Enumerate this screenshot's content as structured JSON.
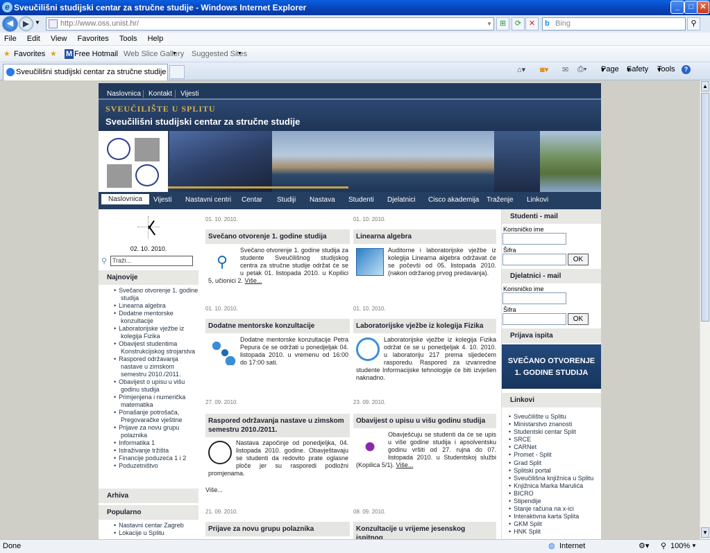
{
  "window": {
    "title": "Sveučilišni studijski centar za stručne studije - Windows Internet Explorer"
  },
  "address": {
    "url": "http://www.oss.unist.hr/",
    "search_placeholder": "Bing"
  },
  "menu": [
    "File",
    "Edit",
    "View",
    "Favorites",
    "Tools",
    "Help"
  ],
  "favorites": {
    "label": "Favorites",
    "items": [
      "Free Hotmail",
      "Web Slice Gallery",
      "Suggested Sites"
    ]
  },
  "tab": {
    "title": "Sveučilišni studijski centar za stručne studije"
  },
  "commands": [
    "Page",
    "Safety",
    "Tools"
  ],
  "site": {
    "topnav": [
      "Naslovnica",
      "Kontakt",
      "Vijesti"
    ],
    "university": "SVEUČILIŠTE U SPLITU",
    "centre": "Sveučilišni studijski centar za stručne studije",
    "mainnav": [
      "Naslovnica",
      "Vijesti",
      "Nastavni centri",
      "Centar",
      "Studiji",
      "Nastava",
      "Studenti",
      "Djelatnici",
      "Cisco akademija",
      "Traženje",
      "Linkovi"
    ],
    "clock_date": "02. 10. 2010.",
    "search_placeholder": "Traži...",
    "najnovije_title": "Najnovije",
    "najnovije": [
      "Svečano otvorenje 1. godine studija",
      "Linearna algebra",
      "Dodatne mentorske konzultacije",
      "Laboratorijske vježbe iz kolegija Fizika",
      "Obavijest studentima Konstrukcijskog strojarstva",
      "Raspored održavanja nastave u zimskom semestru 2010./2011.",
      "Obavijest o upisu u višu godinu studija",
      "Primjenjena i numerička matematika",
      "Ponašanje potrošača, Pregovaračke vještine",
      "Prijave za novu grupu polaznika",
      "Informatika 1",
      "Istraživanje tržišta",
      "Financije poduzeća 1 i 2",
      "Poduzetništvo"
    ],
    "arhiva_title": "Arhiva",
    "popularno_title": "Popularno",
    "popularno": [
      "Nastavni centar Zagreb",
      "Lokacije u Splitu"
    ],
    "news": [
      {
        "date": "01. 10. 2010.",
        "title": "Svečano otvorenje 1. godine studija",
        "body": "Svečano otvorenje 1. godine studija za studente Sveučilišnog studijskog centra za stručne studije održat će se u petak 01. listopada 2010. u Kopilici 5, učionici 2.",
        "more": "Više..."
      },
      {
        "date": "01. 10. 2010.",
        "title": "Linearna algebra",
        "body": "Auditorne i laboratorijske vježbe iz kolegija Linearna algebra održavat će se počevši od 05. listopada 2010. (nakon održanog prvog predavanja).",
        "more": ""
      },
      {
        "date": "01. 10. 2010.",
        "title": "Dodatne mentorske konzultacije",
        "body": "Dodatne mentorske konzultacije Petra Pepura će se održati u ponedjeljak 04. listopada 2010. u vremenu od 16:00 do 17:00 sati.",
        "more": ""
      },
      {
        "date": "01. 10. 2010.",
        "title": "Laboratorijske vježbe iz kolegija Fizika",
        "body": "Laboratorijske vježbe iz kolegija Fizika održat će se u ponedjeljak 4. 10. 2010. u laboratoriju 217 prema sljedećem rasporedu. Raspored za izvanredne studente Informacijske tehnologije će biti izvješen naknadno.",
        "more": ""
      },
      {
        "date": "27. 09. 2010.",
        "title": "Raspored održavanja nastave u zimskom semestru 2010./2011.",
        "body": "Nastava započinje od ponedjeljka, 04. listopada 2010. godine. Obavještavaju se studenti da redovito prate oglasne ploče jer su rasporedi podložni promjenama.",
        "more": ""
      },
      {
        "date": "23. 09. 2010.",
        "title": "Obavijest o upisu u višu godinu studija",
        "body": "Obavješćuju se studenti da će se upis u više godine studija i apsolventsku godinu vršiti od 27. rujna do 07. listopada 2010. u Studentskoj službi (Kopilica 5/1).",
        "more": "Više..."
      },
      {
        "date": "21. 09. 2010.",
        "title": "Prijave za novu grupu polaznika",
        "body": "",
        "more": ""
      },
      {
        "date": "08. 09. 2010.",
        "title": "Konzultacije u vrijeme jesenskog ispitnog",
        "body": "",
        "more": ""
      }
    ],
    "more_all": "Više...",
    "studenti_mail": "Studenti - mail",
    "djelatnici_mail": "Djelatnici - mail",
    "username_label": "Korisničko ime",
    "password_label": "Šifra",
    "ok": "OK",
    "prijava": "Prijava ispita",
    "promo": [
      "SVEČANO OTVORENJE",
      "1. GODINE STUDIJA"
    ],
    "linkovi_title": "Linkovi",
    "linkovi": [
      "Sveučilište u Splitu",
      "Ministarstvo znanosti",
      "Studentski centar Split",
      "SRCE",
      "CARNet",
      "Promet - Split",
      "Grad Split",
      "Splitski portal",
      "Sveučilišna knjižnica u Splitu",
      "Knjižnica Marka Marulića",
      "BICRO",
      "Stipendije",
      "Stanje računa na x-ici",
      "Interaktivna karta Splita",
      "GKM Split",
      "HNK Split"
    ]
  },
  "status": {
    "text": "Done",
    "zone": "Internet",
    "zoom": "100%"
  },
  "colors": {
    "header": "#1f3558",
    "nav": "#253f62",
    "gold": "#d9b24a",
    "promo": "#1b3d6a"
  }
}
